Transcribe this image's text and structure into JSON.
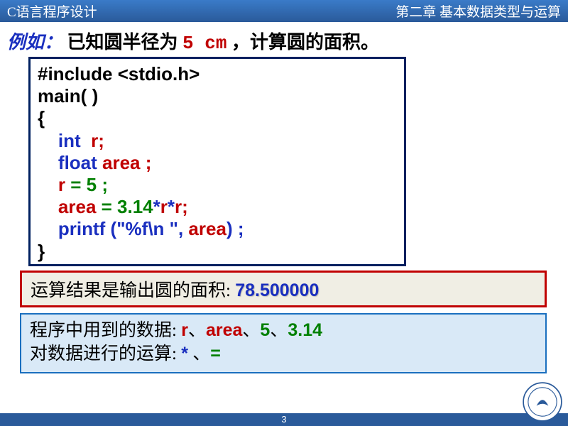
{
  "header": {
    "left": "C语言程序设计",
    "right": "第二章  基本数据类型与运算"
  },
  "example": {
    "label": "例如：",
    "t1": "已知圆半径为",
    "radius": "5 cm",
    "t2": " ，计算圆的面积。"
  },
  "code": {
    "l1": "#include <stdio.h>",
    "l2": "main( )",
    "l3": "{",
    "l4_kw": "int",
    "l4_v": "  r;",
    "l5_kw": "float",
    "l5_v": " area ;",
    "l6_a": "r",
    "l6_b": " = 5 ;",
    "l7_a": "area",
    "l7_b": " = 3.14",
    "l7_c": "*",
    "l7_d": "r",
    "l7_e": "*",
    "l7_f": "r;",
    "l8_a": "printf (\"%f\\n \",",
    "l8_b": " area",
    "l8_c": ") ;",
    "l9": "}"
  },
  "result": {
    "label": "运算结果是输出圆的面积: ",
    "value": "78.500000"
  },
  "data_used": {
    "label1": "程序中用到的数据: ",
    "v1": "r",
    "s1": "、",
    "v2": "area",
    "s2": "、",
    "v3": "5",
    "s3": "、",
    "v4": "3.14",
    "label2": "对数据进行的运算: ",
    "op1": "*",
    "s4": " 、",
    "op2": "="
  },
  "footer": {
    "page": "3"
  }
}
